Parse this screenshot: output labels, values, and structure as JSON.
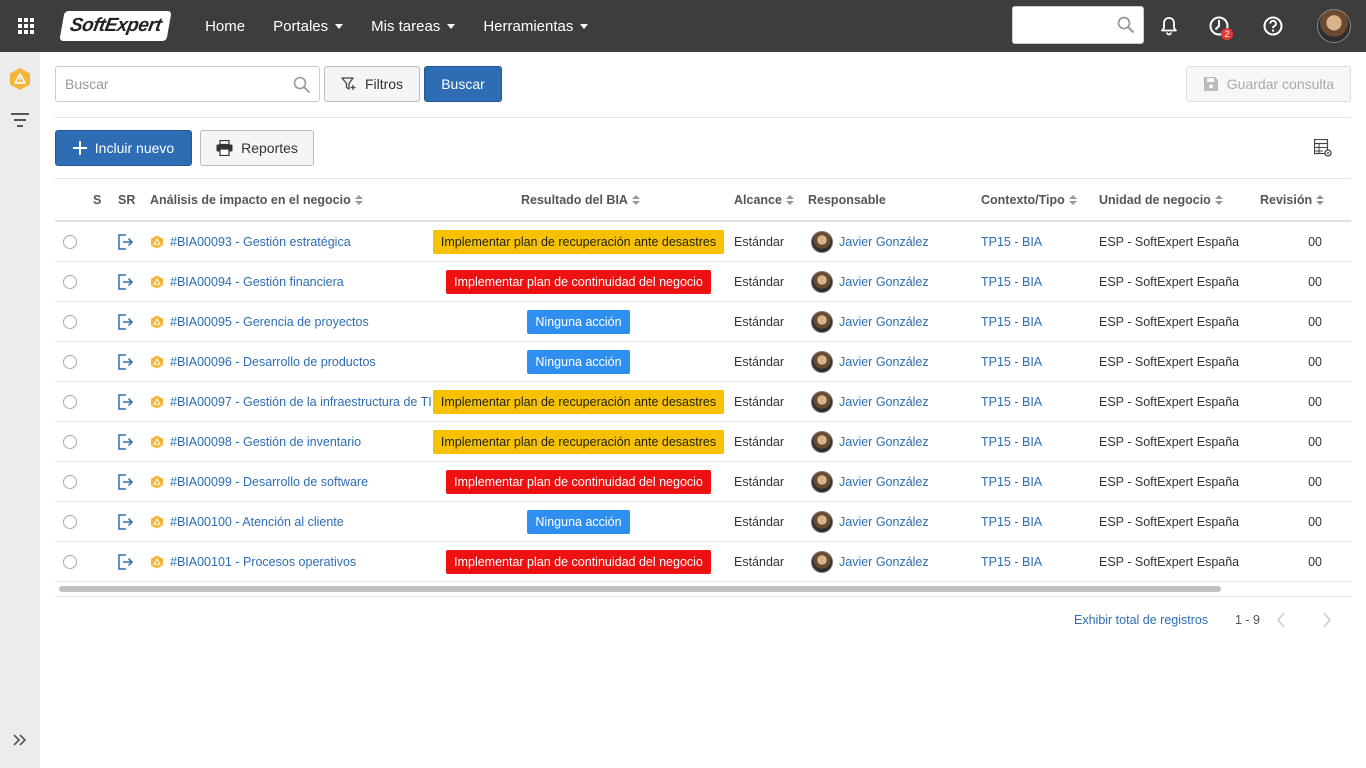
{
  "topbar": {
    "brand_soft": "Soft",
    "brand_expert": "Expert",
    "nav": [
      {
        "label": "Home",
        "has_caret": false
      },
      {
        "label": "Portales",
        "has_caret": true
      },
      {
        "label": "Mis tareas",
        "has_caret": true
      },
      {
        "label": "Herramientas",
        "has_caret": true
      }
    ],
    "search_value": "",
    "notification_badge": "2"
  },
  "toolbar": {
    "search_placeholder": "Buscar",
    "filters_label": "Filtros",
    "search_button_label": "Buscar",
    "save_query_label": "Guardar consulta",
    "new_label": "Incluir nuevo",
    "reports_label": "Reportes"
  },
  "table": {
    "columns": {
      "s": "S",
      "sr": "SR",
      "analysis": "Análisis de impacto en el negocio",
      "result": "Resultado del BIA",
      "scope": "Alcance",
      "responsible": "Responsable",
      "context": "Contexto/Tipo",
      "unit": "Unidad de negocio",
      "revision": "Revisión"
    },
    "rows": [
      {
        "analysis": "#BIA00093 - Gestión estratégica",
        "result": "Implementar plan de recuperación ante desastres",
        "result_color": "yellow",
        "scope": "Estándar",
        "responsible": "Javier González",
        "context": "TP15 - BIA",
        "unit": "ESP - SoftExpert España",
        "revision": "00"
      },
      {
        "analysis": "#BIA00094 - Gestión financiera",
        "result": "Implementar plan de continuidad del negocio",
        "result_color": "red",
        "scope": "Estándar",
        "responsible": "Javier González",
        "context": "TP15 - BIA",
        "unit": "ESP - SoftExpert España",
        "revision": "00"
      },
      {
        "analysis": "#BIA00095 - Gerencia de proyectos",
        "result": "Ninguna acción",
        "result_color": "blue",
        "scope": "Estándar",
        "responsible": "Javier González",
        "context": "TP15 - BIA",
        "unit": "ESP - SoftExpert España",
        "revision": "00"
      },
      {
        "analysis": "#BIA00096 - Desarrollo de productos",
        "result": "Ninguna acción",
        "result_color": "blue",
        "scope": "Estándar",
        "responsible": "Javier González",
        "context": "TP15 - BIA",
        "unit": "ESP - SoftExpert España",
        "revision": "00"
      },
      {
        "analysis": "#BIA00097 - Gestión de la infraestructura de TI",
        "result": "Implementar plan de recuperación ante desastres",
        "result_color": "yellow",
        "scope": "Estándar",
        "responsible": "Javier González",
        "context": "TP15 - BIA",
        "unit": "ESP - SoftExpert España",
        "revision": "00"
      },
      {
        "analysis": "#BIA00098 - Gestión de inventario",
        "result": "Implementar plan de recuperación ante desastres",
        "result_color": "yellow",
        "scope": "Estándar",
        "responsible": "Javier González",
        "context": "TP15 - BIA",
        "unit": "ESP - SoftExpert España",
        "revision": "00"
      },
      {
        "analysis": "#BIA00099 - Desarrollo de software",
        "result": "Implementar plan de continuidad del negocio",
        "result_color": "red",
        "scope": "Estándar",
        "responsible": "Javier González",
        "context": "TP15 - BIA",
        "unit": "ESP - SoftExpert España",
        "revision": "00"
      },
      {
        "analysis": "#BIA00100 - Atención al cliente",
        "result": "Ninguna acción",
        "result_color": "blue",
        "scope": "Estándar",
        "responsible": "Javier González",
        "context": "TP15 - BIA",
        "unit": "ESP - SoftExpert España",
        "revision": "00"
      },
      {
        "analysis": "#BIA00101 - Procesos operativos",
        "result": "Implementar plan de continuidad del negocio",
        "result_color": "red",
        "scope": "Estándar",
        "responsible": "Javier González",
        "context": "TP15 - BIA",
        "unit": "ESP - SoftExpert España",
        "revision": "00"
      }
    ]
  },
  "footer": {
    "show_total_label": "Exhibir total de registros",
    "range": "1 - 9"
  },
  "colors": {
    "topbar": "#3d3d3d",
    "primary": "#2e6db4",
    "tag_yellow": "#f7c100",
    "tag_red": "#ee1111",
    "tag_blue": "#2f8ff0"
  }
}
